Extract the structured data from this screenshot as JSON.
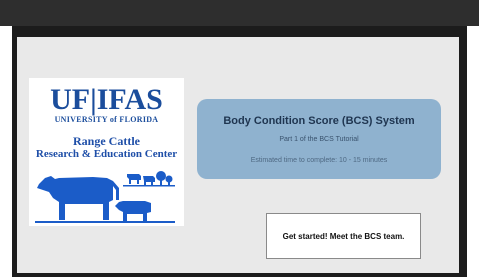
{
  "logo": {
    "brand": "UF|IFAS",
    "university": "UNIVERSITY of FLORIDA",
    "center_line1": "Range Cattle",
    "center_line2": "Research & Education Center"
  },
  "header_panel": {
    "title": "Body Condition Score (BCS) System",
    "subtitle": "Part 1 of the BCS Tutorial",
    "time_estimate": "Estimated time to complete: 10 - 15 minutes"
  },
  "actions": {
    "start_label": "Get started! Meet the BCS team."
  },
  "colors": {
    "brand_blue": "#1b4d9c",
    "title_box": "#8fb2cf",
    "frame_dark": "#1c1c1c"
  },
  "icons": {
    "cattle": "cattle-illustration-icon"
  }
}
